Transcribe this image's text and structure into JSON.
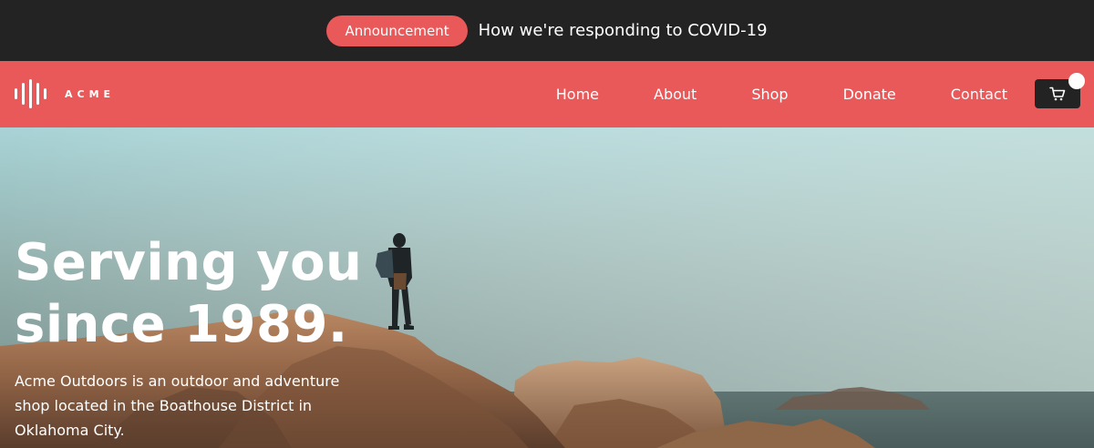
{
  "announcement": {
    "badge_label": "Announcement",
    "link_text": "How we're responding to COVID-19"
  },
  "header": {
    "brand_name": "ACME",
    "nav": [
      {
        "label": "Home"
      },
      {
        "label": "About"
      },
      {
        "label": "Shop"
      },
      {
        "label": "Donate"
      },
      {
        "label": "Contact"
      }
    ],
    "cart_icon": "cart-icon"
  },
  "hero": {
    "title_line1": "Serving you",
    "title_line2": "since 1989.",
    "description": "Acme Outdoors is an outdoor and adventure shop located in the Boathouse District in Oklahoma City."
  },
  "colors": {
    "brand": "#e9595a",
    "dark": "#232323"
  }
}
